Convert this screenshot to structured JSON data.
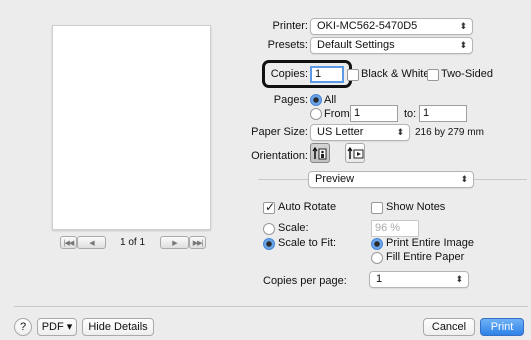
{
  "preview": {
    "page_indicator": "1 of 1",
    "first_icon": "first-page-icon",
    "prev_icon": "previous-page-icon",
    "next_icon": "next-page-icon",
    "last_icon": "last-page-icon"
  },
  "printer": {
    "label": "Printer:",
    "value": "OKI-MC562-5470D5"
  },
  "presets": {
    "label": "Presets:",
    "value": "Default Settings"
  },
  "copies": {
    "label": "Copies:",
    "value": "1",
    "black_white_label": "Black & White",
    "black_white_checked": false,
    "two_sided_label": "Two-Sided",
    "two_sided_checked": false
  },
  "pages": {
    "label": "Pages:",
    "all_label": "All",
    "from_label": "From:",
    "from_value": "1",
    "to_label": "to:",
    "to_value": "1",
    "selected": "all"
  },
  "paper_size": {
    "label": "Paper Size:",
    "value": "US Letter",
    "dimensions": "216 by 279 mm"
  },
  "orientation": {
    "label": "Orientation:",
    "selected": "portrait"
  },
  "section_popup": {
    "value": "Preview"
  },
  "preview_options": {
    "auto_rotate_label": "Auto Rotate",
    "auto_rotate_checked": true,
    "show_notes_label": "Show Notes",
    "show_notes_checked": false,
    "scale_label": "Scale:",
    "scale_value": "96 %",
    "scale_to_fit_label": "Scale to Fit:",
    "scaling_selected": "scale-to-fit",
    "print_entire_image_label": "Print Entire Image",
    "fill_entire_paper_label": "Fill Entire Paper",
    "fit_selected": "print-entire-image"
  },
  "copies_per_page": {
    "label": "Copies per page:",
    "value": "1"
  },
  "bottom_bar": {
    "help_label": "?",
    "pdf_label": "PDF ▾",
    "hide_details_label": "Hide Details",
    "cancel_label": "Cancel",
    "print_label": "Print"
  },
  "colors": {
    "accent": "#2e81e8",
    "focus_ring": "#111111",
    "background": "#ececec"
  }
}
